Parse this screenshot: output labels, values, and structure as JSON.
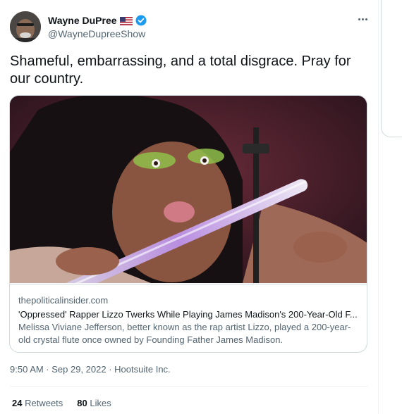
{
  "author": {
    "display_name": "Wayne DuPree",
    "handle": "@WayneDupreeShow",
    "flag_icon": "us-flag-icon",
    "verified_icon": "verified-badge-icon"
  },
  "tweet": {
    "text": "Shameful, embarrassing, and a total disgrace. Pray for our country.",
    "timestamp": "9:50 AM · Sep 29, 2022",
    "source": "Hootsuite Inc."
  },
  "card": {
    "domain": "thepoliticalinsider.com",
    "title": "'Oppressed' Rapper Lizzo Twerks While Playing James Madison's 200-Year-Old F...",
    "description": "Melissa Viviane Jefferson, better known as the rap artist Lizzo, played a 200-year-old crystal flute once owned by Founding Father James Madison."
  },
  "stats": {
    "retweets_count": "24",
    "retweets_label": "Retweets",
    "likes_count": "80",
    "likes_label": "Likes"
  },
  "colors": {
    "text_primary": "#0f1419",
    "text_secondary": "#536471",
    "border": "#cfd9de",
    "verified": "#1d9bf0"
  }
}
